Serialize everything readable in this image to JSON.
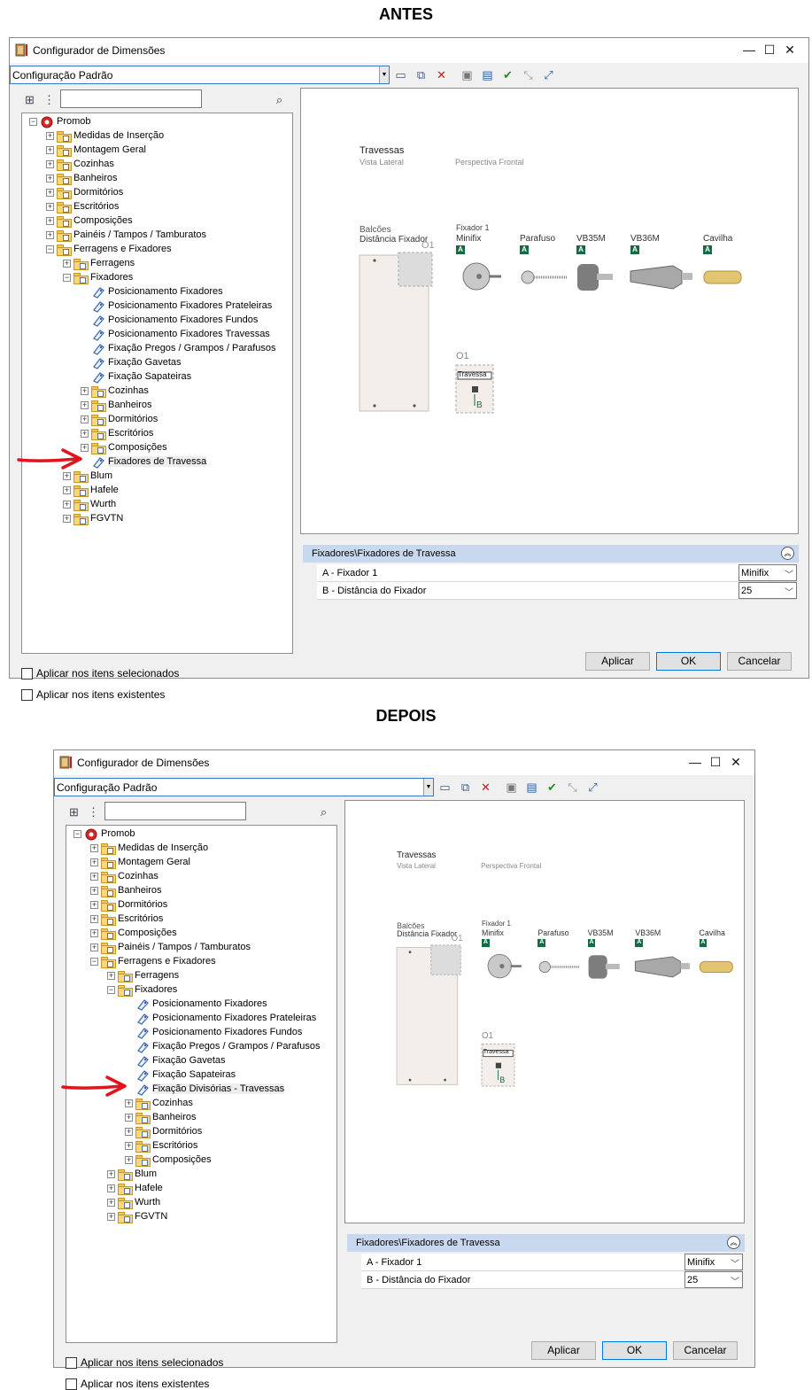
{
  "headings": {
    "before": "ANTES",
    "after": "DEPOIS"
  },
  "window": {
    "title": "Configurador de Dimensões",
    "minimize": "—",
    "maximize": "☐",
    "close": "✕",
    "config_value": "Configuração Padrão"
  },
  "tree_before": [
    {
      "label": "Promob",
      "level": 0,
      "icon": "promob",
      "exp": "−"
    },
    {
      "label": "Medidas de Inserção",
      "level": 1,
      "icon": "folder",
      "exp": "+"
    },
    {
      "label": "Montagem Geral",
      "level": 1,
      "icon": "folder",
      "exp": "+"
    },
    {
      "label": "Cozinhas",
      "level": 1,
      "icon": "folder",
      "exp": "+"
    },
    {
      "label": "Banheiros",
      "level": 1,
      "icon": "folder",
      "exp": "+"
    },
    {
      "label": "Dormitórios",
      "level": 1,
      "icon": "folder",
      "exp": "+"
    },
    {
      "label": "Escritórios",
      "level": 1,
      "icon": "folder",
      "exp": "+"
    },
    {
      "label": "Composições",
      "level": 1,
      "icon": "folder",
      "exp": "+"
    },
    {
      "label": "Painéis / Tampos / Tamburatos",
      "level": 1,
      "icon": "folder",
      "exp": "+"
    },
    {
      "label": "Ferragens e Fixadores",
      "level": 1,
      "icon": "folder",
      "exp": "−"
    },
    {
      "label": "Ferragens",
      "level": 2,
      "icon": "folder",
      "exp": "+"
    },
    {
      "label": "Fixadores",
      "level": 2,
      "icon": "folder",
      "exp": "−"
    },
    {
      "label": "Posicionamento Fixadores",
      "level": 3,
      "icon": "tag"
    },
    {
      "label": "Posicionamento Fixadores Prateleiras",
      "level": 3,
      "icon": "tag"
    },
    {
      "label": "Posicionamento Fixadores Fundos",
      "level": 3,
      "icon": "tag"
    },
    {
      "label": "Posicionamento Fixadores Travessas",
      "level": 3,
      "icon": "tag"
    },
    {
      "label": "Fixação Pregos / Grampos / Parafusos",
      "level": 3,
      "icon": "tag"
    },
    {
      "label": "Fixação Gavetas",
      "level": 3,
      "icon": "tag"
    },
    {
      "label": "Fixação Sapateiras",
      "level": 3,
      "icon": "tag"
    },
    {
      "label": "Cozinhas",
      "level": 3,
      "icon": "folder",
      "exp": "+"
    },
    {
      "label": "Banheiros",
      "level": 3,
      "icon": "folder",
      "exp": "+"
    },
    {
      "label": "Dormitórios",
      "level": 3,
      "icon": "folder",
      "exp": "+"
    },
    {
      "label": "Escritórios",
      "level": 3,
      "icon": "folder",
      "exp": "+"
    },
    {
      "label": "Composições",
      "level": 3,
      "icon": "folder",
      "exp": "+"
    },
    {
      "label": "Fixadores de Travessa",
      "level": 3,
      "icon": "tag",
      "selected": true
    },
    {
      "label": "Blum",
      "level": 2,
      "icon": "folder",
      "exp": "+"
    },
    {
      "label": "Hafele",
      "level": 2,
      "icon": "folder",
      "exp": "+"
    },
    {
      "label": "Wurth",
      "level": 2,
      "icon": "folder",
      "exp": "+"
    },
    {
      "label": "FGVTN",
      "level": 2,
      "icon": "folder",
      "exp": "+"
    }
  ],
  "tree_after": [
    {
      "label": "Promob",
      "level": 0,
      "icon": "promob",
      "exp": "−"
    },
    {
      "label": "Medidas de Inserção",
      "level": 1,
      "icon": "folder",
      "exp": "+"
    },
    {
      "label": "Montagem Geral",
      "level": 1,
      "icon": "folder",
      "exp": "+"
    },
    {
      "label": "Cozinhas",
      "level": 1,
      "icon": "folder",
      "exp": "+"
    },
    {
      "label": "Banheiros",
      "level": 1,
      "icon": "folder",
      "exp": "+"
    },
    {
      "label": "Dormitórios",
      "level": 1,
      "icon": "folder",
      "exp": "+"
    },
    {
      "label": "Escritórios",
      "level": 1,
      "icon": "folder",
      "exp": "+"
    },
    {
      "label": "Composições",
      "level": 1,
      "icon": "folder",
      "exp": "+"
    },
    {
      "label": "Painéis / Tampos / Tamburatos",
      "level": 1,
      "icon": "folder",
      "exp": "+"
    },
    {
      "label": "Ferragens e Fixadores",
      "level": 1,
      "icon": "folder",
      "exp": "−"
    },
    {
      "label": "Ferragens",
      "level": 2,
      "icon": "folder",
      "exp": "+"
    },
    {
      "label": "Fixadores",
      "level": 2,
      "icon": "folder",
      "exp": "−"
    },
    {
      "label": "Posicionamento Fixadores",
      "level": 3,
      "icon": "tag"
    },
    {
      "label": "Posicionamento Fixadores Prateleiras",
      "level": 3,
      "icon": "tag"
    },
    {
      "label": "Posicionamento Fixadores Fundos",
      "level": 3,
      "icon": "tag"
    },
    {
      "label": "Fixação Pregos / Grampos / Parafusos",
      "level": 3,
      "icon": "tag"
    },
    {
      "label": "Fixação Gavetas",
      "level": 3,
      "icon": "tag"
    },
    {
      "label": "Fixação Sapateiras",
      "level": 3,
      "icon": "tag"
    },
    {
      "label": "Fixação Divisórias - Travessas",
      "level": 3,
      "icon": "tag",
      "selected": true
    },
    {
      "label": "Cozinhas",
      "level": 3,
      "icon": "folder",
      "exp": "+"
    },
    {
      "label": "Banheiros",
      "level": 3,
      "icon": "folder",
      "exp": "+"
    },
    {
      "label": "Dormitórios",
      "level": 3,
      "icon": "folder",
      "exp": "+"
    },
    {
      "label": "Escritórios",
      "level": 3,
      "icon": "folder",
      "exp": "+"
    },
    {
      "label": "Composições",
      "level": 3,
      "icon": "folder",
      "exp": "+"
    },
    {
      "label": "Blum",
      "level": 2,
      "icon": "folder",
      "exp": "+"
    },
    {
      "label": "Hafele",
      "level": 2,
      "icon": "folder",
      "exp": "+"
    },
    {
      "label": "Wurth",
      "level": 2,
      "icon": "folder",
      "exp": "+"
    },
    {
      "label": "FGVTN",
      "level": 2,
      "icon": "folder",
      "exp": "+"
    }
  ],
  "preview": {
    "title": "Travessas",
    "subtitle_left": "Vista Lateral",
    "subtitle_right": "Perspectiva Frontal",
    "balcoes": "Balcões",
    "distancia": "Distância Fixador",
    "o1": "O1",
    "fixador1": "Fixador 1",
    "badge_a": "A",
    "badge_b": "B",
    "travessa": "Travessa",
    "items": [
      "Minifix",
      "Parafuso",
      "VB35M",
      "VB36M",
      "Cavilha"
    ]
  },
  "props": {
    "header": "Fixadores\\Fixadores de Travessa",
    "collapse": "︽",
    "row1_label": "A - Fixador 1",
    "row1_value": "Minifix",
    "row2_label": "B - Distância do Fixador",
    "row2_value": "25",
    "arrow": "﹀"
  },
  "options": {
    "apply_selected": "Aplicar nos itens selecionados",
    "apply_existing": "Aplicar nos itens existentes"
  },
  "buttons": {
    "apply": "Aplicar",
    "ok": "OK",
    "cancel": "Cancelar"
  },
  "colors": {
    "badge": "#156b44",
    "props_header": "#c8d9ef",
    "arrow": "#e0141c"
  }
}
